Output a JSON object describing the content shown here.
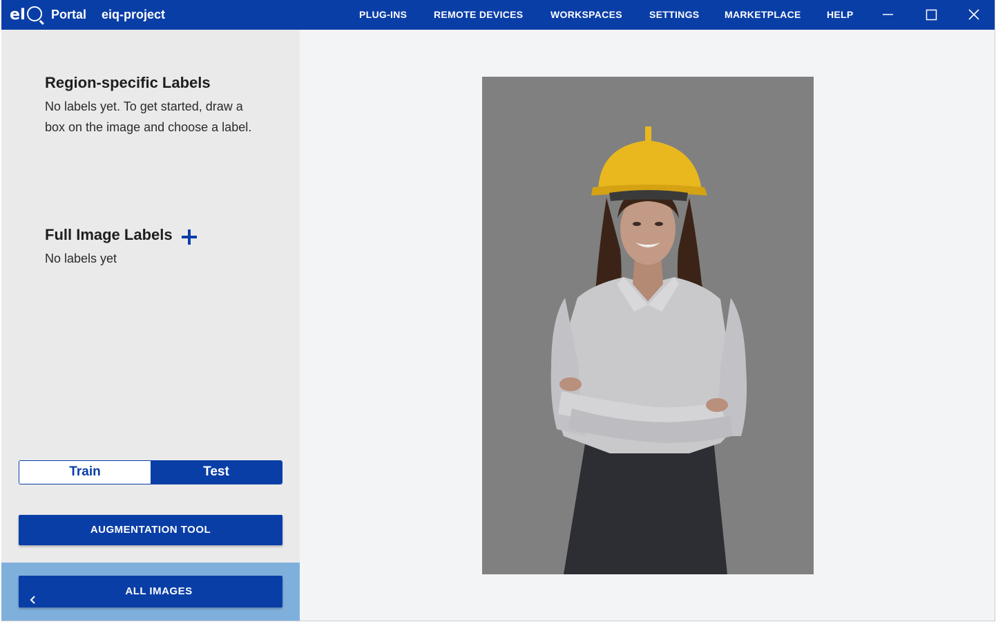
{
  "titlebar": {
    "logo_text": "eIQ",
    "app_name": "Portal",
    "project_name": "eiq-project",
    "nav": [
      "PLUG-INS",
      "REMOTE DEVICES",
      "WORKSPACES",
      "SETTINGS",
      "MARKETPLACE",
      "HELP"
    ],
    "window_controls": [
      "minimize-icon",
      "maximize-icon",
      "close-icon"
    ]
  },
  "sidebar": {
    "region_labels": {
      "title": "Region-specific Labels",
      "empty_text": "No labels yet. To get started, draw a box on the image and choose a label."
    },
    "full_image_labels": {
      "title": "Full Image Labels",
      "empty_text": "No labels yet",
      "add_icon": "plus-icon"
    },
    "dataset_toggle": {
      "options": [
        "Train",
        "Test"
      ],
      "selected": "Test"
    },
    "augmentation_button": "AUGMENTATION TOOL",
    "all_images_button": "ALL IMAGES",
    "all_images_icon": "chevron-left-icon"
  },
  "main": {
    "image_subject": "woman in yellow hard hat, white shirt, arms crossed"
  },
  "colors": {
    "accent": "#0a3ea7",
    "sidebar_bg": "#eaeaeb",
    "footer_band": "#7fb0dc",
    "canvas_bg": "#f3f4f6",
    "image_bg": "#808080",
    "helmet": "#e9b81f"
  }
}
